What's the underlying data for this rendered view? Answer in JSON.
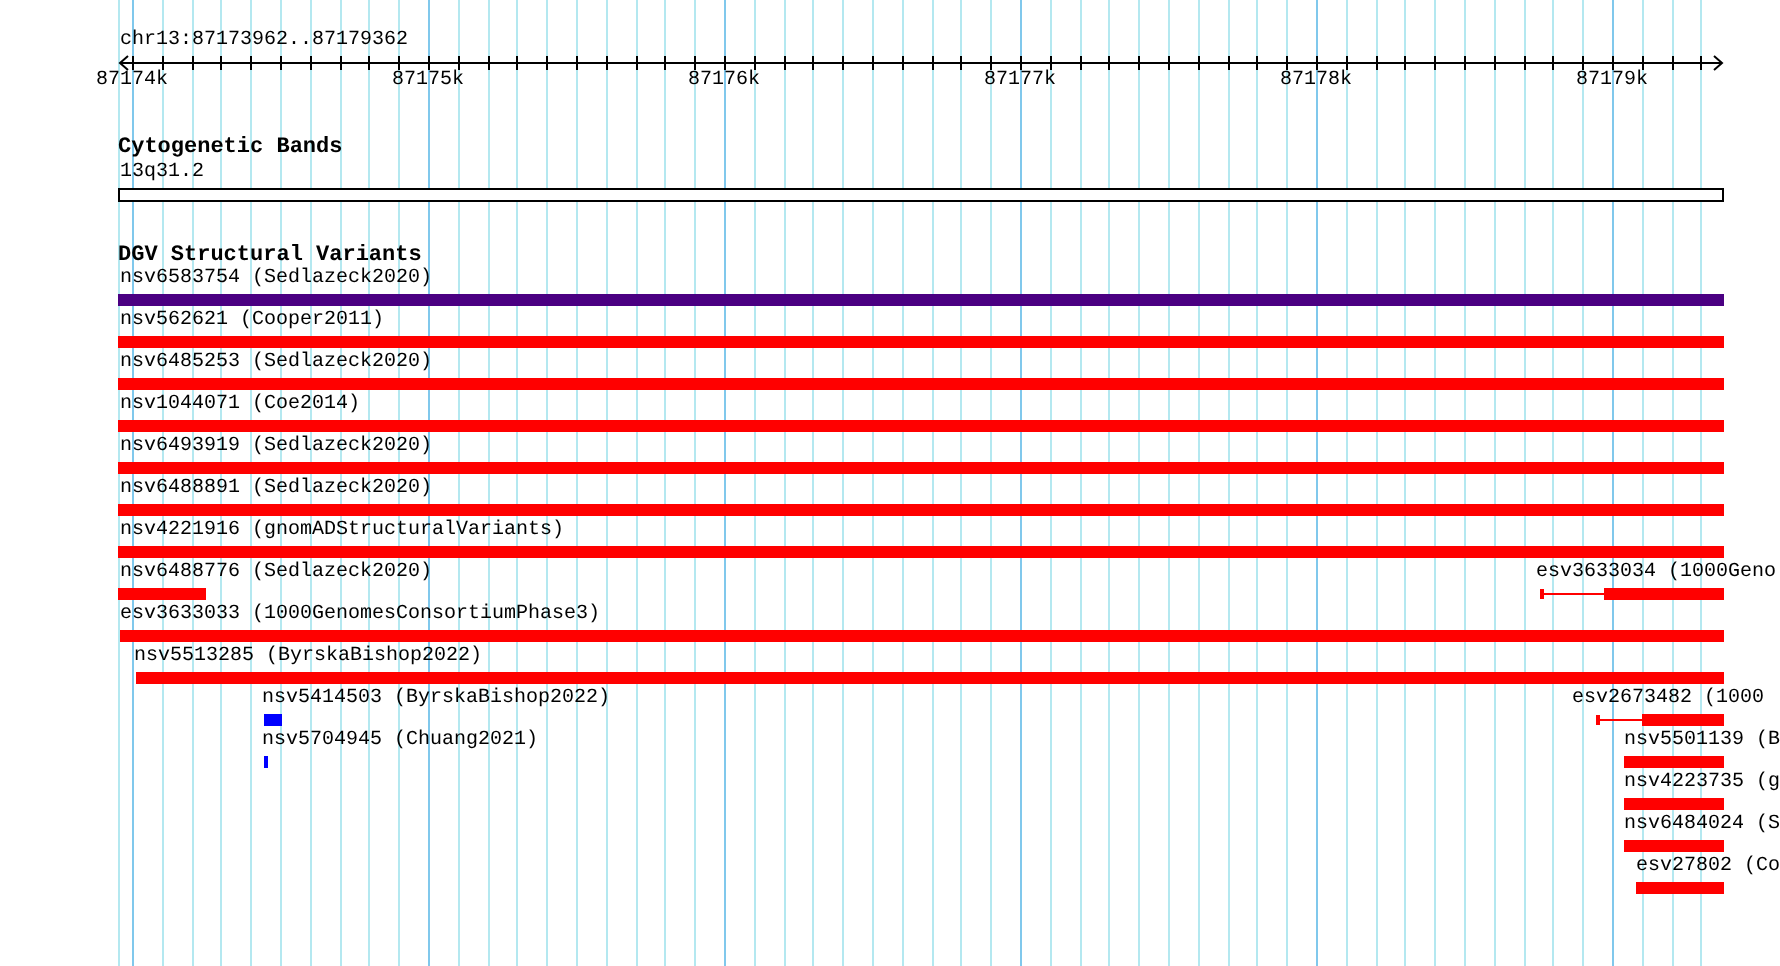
{
  "ruler": {
    "location": "chr13:87173962..87179362",
    "ticks": [
      "87174k",
      "87175k",
      "87176k",
      "87177k",
      "87178k",
      "87179k"
    ]
  },
  "tracks": [
    {
      "title": "Cytogenetic Bands",
      "kind": "bands",
      "features": [
        {
          "label": "13q31.2"
        }
      ]
    },
    {
      "title": "DGV Structural Variants",
      "kind": "variants",
      "features": [
        {
          "label": "nsv6583754 (Sedlazeck2020)",
          "kind": "box",
          "color": "#4b0082"
        },
        {
          "label": "nsv562621 (Cooper2011)",
          "kind": "box",
          "color": "#ff0000"
        },
        {
          "label": "nsv6485253 (Sedlazeck2020)",
          "kind": "box",
          "color": "#ff0000"
        },
        {
          "label": "nsv1044071 (Coe2014)",
          "kind": "box",
          "color": "#ff0000"
        },
        {
          "label": "nsv6493919 (Sedlazeck2020)",
          "kind": "box",
          "color": "#ff0000"
        },
        {
          "label": "nsv6488891 (Sedlazeck2020)",
          "kind": "box",
          "color": "#ff0000"
        },
        {
          "label": "nsv4221916 (gnomADStructuralVariants)",
          "kind": "box",
          "color": "#ff0000"
        },
        {
          "label": "nsv6488776 (Sedlazeck2020)",
          "kind": "box",
          "color": "#ff0000"
        },
        {
          "label": "esv3633034 (1000Geno",
          "kind": "split",
          "color": "#ff0000"
        },
        {
          "label": "esv3633033 (1000GenomesConsortiumPhase3)",
          "kind": "box",
          "color": "#ff0000"
        },
        {
          "label": "nsv5513285 (ByrskaBishop2022)",
          "kind": "box",
          "color": "#ff0000"
        },
        {
          "label": "nsv5414503 (ByrskaBishop2022)",
          "kind": "box",
          "color": "#0000ff"
        },
        {
          "label": "nsv5704945 (Chuang2021)",
          "kind": "box",
          "color": "#0000ff"
        },
        {
          "label": "esv2673482 (1000",
          "kind": "split",
          "color": "#ff0000"
        },
        {
          "label": "nsv5501139 (B",
          "kind": "box",
          "color": "#ff0000"
        },
        {
          "label": "nsv4223735 (g",
          "kind": "box",
          "color": "#ff0000"
        },
        {
          "label": "nsv6484024 (S",
          "kind": "box",
          "color": "#ff0000"
        },
        {
          "label": "esv27802 (Co",
          "kind": "box",
          "color": "#ff0000"
        }
      ]
    }
  ]
}
